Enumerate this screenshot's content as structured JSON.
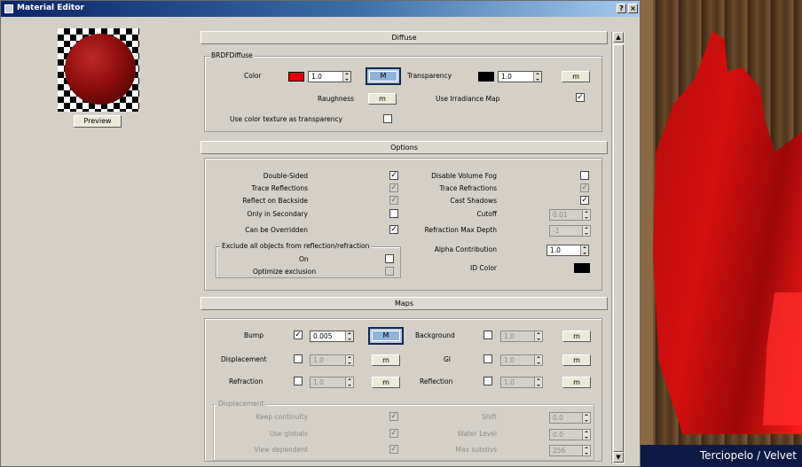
{
  "window": {
    "title": "Material Editor",
    "help_label": "?",
    "close_label": "×"
  },
  "preview": {
    "button_label": "Preview"
  },
  "diffuse": {
    "header": "Diffuse",
    "group_title": "BRDFDiffuse",
    "color_label": "Color",
    "color_swatch": "#e00000",
    "color_value": "1.0",
    "map_button": "M",
    "transparency_label": "Transparency",
    "transparency_swatch": "#000000",
    "transparency_value": "1.0",
    "transparency_map": "m",
    "roughness_label": "Raughness",
    "roughness_map": "m",
    "irradiance_label": "Use Irradiance Map",
    "irradiance_checked": "✓",
    "color_texture_label": "Use color texture as transparency"
  },
  "options": {
    "header": "Options",
    "double_sided": "Double-Sided",
    "trace_reflections": "Trace Reflections",
    "reflect_backside": "Reflect on Backside",
    "only_secondary": "Only in Secondary",
    "can_overridden": "Can be Overridden",
    "disable_fog": "Disable Volume Fog",
    "trace_refractions": "Trace Refractions",
    "cast_shadows": "Cast Shadows",
    "cutoff": "Cutoff",
    "cutoff_value": "0.01",
    "refraction_depth": "Refraction Max Depth",
    "refraction_depth_value": "-1",
    "alpha_contribution": "Alpha Contribution",
    "alpha_value": "1.0",
    "id_color": "ID Color",
    "id_swatch": "#000000",
    "check": "✓",
    "exclude_title": "Exclude all objects from reflection/refraction",
    "exclude_on": "On",
    "optimize_exclusion": "Optimize exclusion"
  },
  "maps": {
    "header": "Maps",
    "bump": "Bump",
    "bump_value": "0.005",
    "bump_map": "M",
    "background": "Background",
    "background_value": "1.0",
    "displacement": "Displacement",
    "displacement_value": "1.0",
    "gi": "GI",
    "gi_value": "1.0",
    "refraction": "Refraction",
    "refraction_value": "1.0",
    "reflection": "Reflection",
    "reflection_value": "1.0",
    "small_map": "m",
    "check": "✓"
  },
  "displacement": {
    "group_title": "Displacement",
    "keep_continuity": "Keep continuity",
    "use_globals": "Use globals",
    "view_dependent": "View dependent",
    "shift": "Shift",
    "shift_value": "0.0",
    "water_level": "Water Level",
    "water_value": "0.0",
    "max_subdivs": "Max subdivs",
    "max_subdivs_value": "256",
    "check": "✓"
  },
  "caption": "Terciopelo / Velvet"
}
